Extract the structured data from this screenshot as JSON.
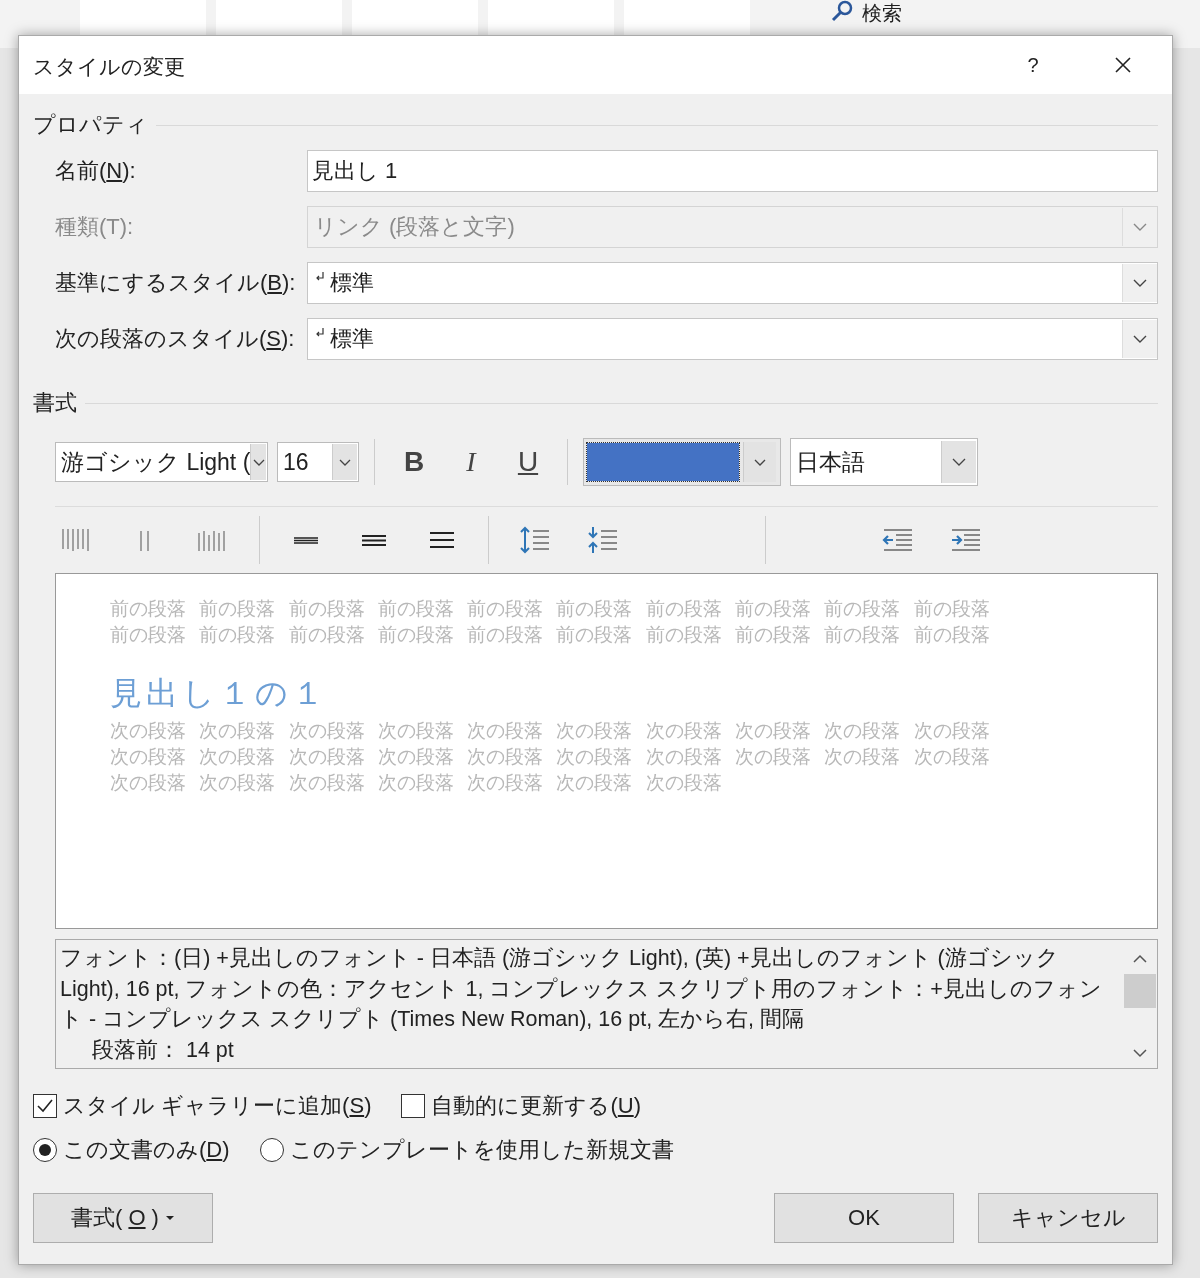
{
  "background": {
    "search": "検索"
  },
  "dialog": {
    "title": "スタイルの変更",
    "help": "?"
  },
  "properties": {
    "heading": "プロパティ",
    "fields": [
      {
        "kind": "text",
        "pre": "名前(",
        "key": "N",
        "post": "):",
        "value": "見出し 1"
      },
      {
        "kind": "dropdown",
        "pre": "種類(T):",
        "value": "リンク (段落と文字)",
        "disabled": true,
        "mark": false
      },
      {
        "kind": "dropdown",
        "pre": "基準にするスタイル(",
        "key": "B",
        "post": "):",
        "value": "標準",
        "disabled": false,
        "mark": true
      },
      {
        "kind": "dropdown",
        "pre": "次の段落のスタイル(",
        "key": "S",
        "post": "):",
        "value": "標準",
        "disabled": false,
        "mark": true
      }
    ]
  },
  "formatting": {
    "heading": "書式",
    "font": "游ゴシック Light (",
    "size": "16",
    "styles": [
      {
        "kind": "bold",
        "label": "B",
        "pressed": false
      },
      {
        "kind": "italic",
        "label": "I",
        "pressed": false
      },
      {
        "kind": "underline",
        "label": "U",
        "pressed": false
      }
    ],
    "color": "#4472c4",
    "language": "日本語"
  },
  "preview": {
    "before": [
      "前の段落 前の段落 前の段落 前の段落 前の段落 前の段落 前の段落 前の段落 前の段落 前の段落",
      "前の段落 前の段落 前の段落 前の段落 前の段落 前の段落 前の段落 前の段落 前の段落 前の段落"
    ],
    "heading": "見出し１の１",
    "after": [
      "次の段落 次の段落 次の段落 次の段落 次の段落 次の段落 次の段落 次の段落 次の段落 次の段落",
      "次の段落 次の段落 次の段落 次の段落 次の段落 次の段落 次の段落 次の段落 次の段落 次の段落",
      "次の段落 次の段落 次の段落 次の段落 次の段落 次の段落 次の段落"
    ]
  },
  "description": [
    {
      "text": "フォント：(日) +見出しのフォント - 日本語 (游ゴシック Light), (英) +見出しのフォント (游ゴシック Light), 16 pt, フォントの色：アクセント 1, コンプレックス スクリプト用のフォント：+見出しのフォント - コンプレックス スクリプト (Times New Roman), 16 pt, 左から右, 間隔",
      "indented": false
    },
    {
      "text": "段落前： 14 pt",
      "indented": true
    }
  ],
  "checkboxes": [
    {
      "pre": "スタイル ギャラリーに追加(",
      "key": "S",
      "post": ")",
      "checked": true
    },
    {
      "pre": "自動的に更新する(",
      "key": "U",
      "post": ")",
      "checked": false
    }
  ],
  "radios": [
    {
      "pre": "この文書のみ(",
      "key": "D",
      "post": ")",
      "selected": true
    },
    {
      "pre": "このテンプレートを使用した新規文書",
      "selected": false
    }
  ],
  "buttons": {
    "format": {
      "pre": "書式(",
      "key": "O",
      "post": ")"
    },
    "ok": "OK",
    "cancel": "キャンセル"
  }
}
